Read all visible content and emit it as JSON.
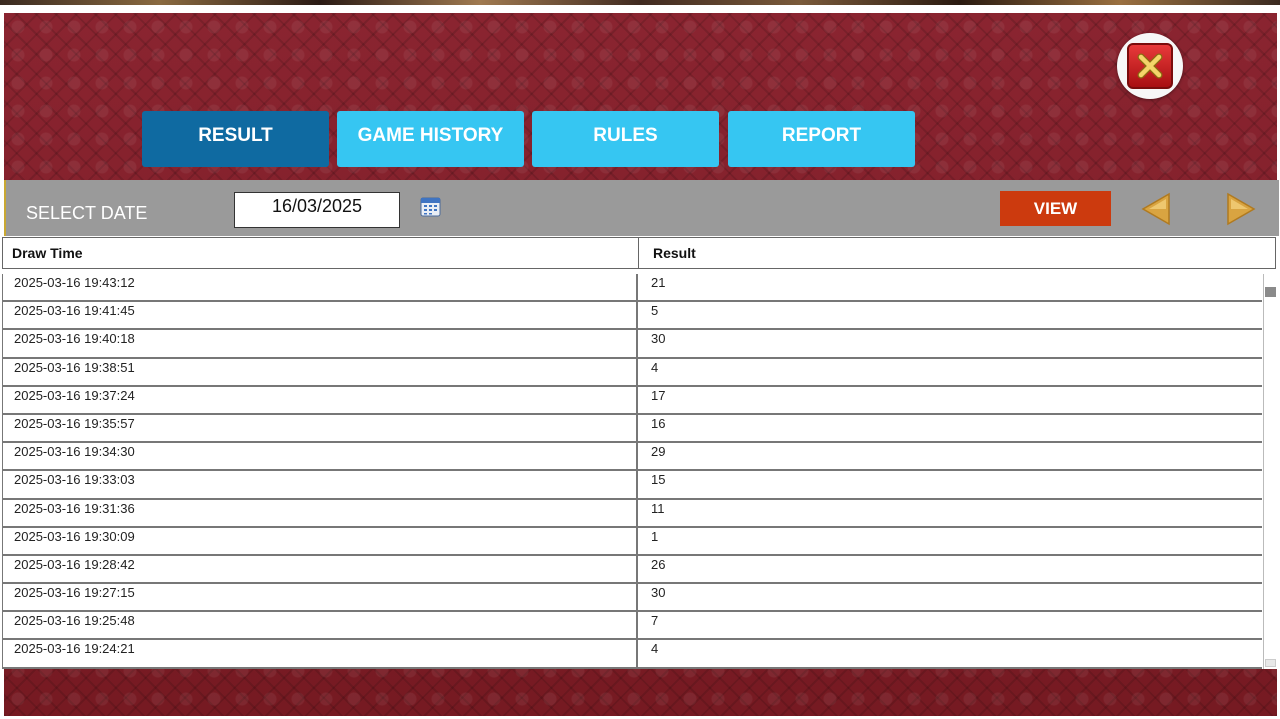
{
  "tabs": [
    {
      "label": "RESULT",
      "active": true
    },
    {
      "label": "GAME HISTORY",
      "active": false
    },
    {
      "label": "RULES",
      "active": false
    },
    {
      "label": "REPORT",
      "active": false
    }
  ],
  "toolbar": {
    "select_date_label": "SELECT DATE",
    "date_value": "16/03/2025",
    "view_label": "VIEW"
  },
  "table": {
    "headers": [
      "Draw Time",
      "Result"
    ],
    "rows": [
      {
        "time": "2025-03-16 19:43:12",
        "result": "21"
      },
      {
        "time": "2025-03-16 19:41:45",
        "result": "5"
      },
      {
        "time": "2025-03-16 19:40:18",
        "result": "30"
      },
      {
        "time": "2025-03-16 19:38:51",
        "result": "4"
      },
      {
        "time": "2025-03-16 19:37:24",
        "result": "17"
      },
      {
        "time": "2025-03-16 19:35:57",
        "result": "16"
      },
      {
        "time": "2025-03-16 19:34:30",
        "result": "29"
      },
      {
        "time": "2025-03-16 19:33:03",
        "result": "15"
      },
      {
        "time": "2025-03-16 19:31:36",
        "result": "11"
      },
      {
        "time": "2025-03-16 19:30:09",
        "result": "1"
      },
      {
        "time": "2025-03-16 19:28:42",
        "result": "26"
      },
      {
        "time": "2025-03-16 19:27:15",
        "result": "30"
      },
      {
        "time": "2025-03-16 19:25:48",
        "result": "7"
      },
      {
        "time": "2025-03-16 19:24:21",
        "result": "4"
      }
    ]
  },
  "colors": {
    "background": "#7e1e26",
    "tab_active": "#0f6aa1",
    "tab_inactive": "#36c6f2",
    "view_button": "#cc3a0e",
    "toolbar": "#9a9a9a",
    "arrow": "#d9a441"
  },
  "icons": {
    "close": "close-icon",
    "calendar": "calendar-icon",
    "prev": "arrow-left-icon",
    "next": "arrow-right-icon"
  }
}
